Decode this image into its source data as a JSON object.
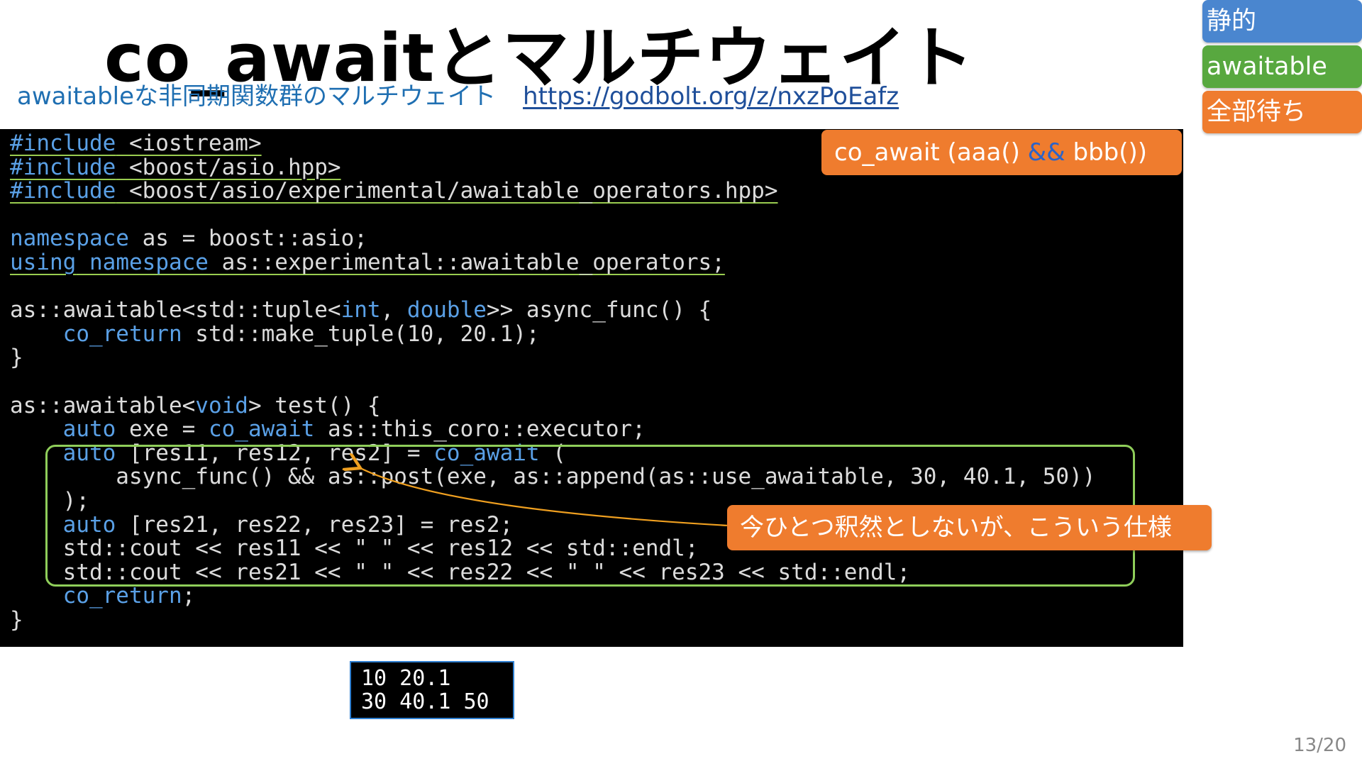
{
  "slide": {
    "title": "co_awaitとマルチウェイト",
    "subtitle": "awaitableな非同期関数群のマルチウェイト",
    "link": "https://godbolt.org/z/nxzPoEafz",
    "page_number": "13/20"
  },
  "tags": {
    "static": "静的",
    "awaitable": "awaitable",
    "all_wait": "全部待ち"
  },
  "callouts": {
    "expr_prefix": "co_await (aaa() ",
    "expr_amp": "&&",
    "expr_suffix": " bbb())",
    "note": "今ひとつ釈然としないが、こういう仕様"
  },
  "code": {
    "l1_pp": "#include",
    "l1_rest": " <iostream>",
    "l2_pp": "#include",
    "l2_rest": " <boost/asio.hpp>",
    "l3_pp": "#include",
    "l3_rest": " <boost/asio/experimental/awaitable_operators.hpp>",
    "l5_kw": "namespace",
    "l5_rest": " as = boost::asio;",
    "l6_kw1": "using",
    "l6_sp": " ",
    "l6_kw2": "namespace",
    "l6_rest": " as::experimental::awaitable_operators;",
    "l8_a": "as::awaitable<std::tuple<",
    "l8_kw1": "int",
    "l8_b": ", ",
    "l8_kw2": "double",
    "l8_c": ">> async_func() {",
    "l9_indent": "    ",
    "l9_kw": "co_return",
    "l9_rest": " std::make_tuple(10, 20.1);",
    "l10": "}",
    "l12_a": "as::awaitable<",
    "l12_kw": "void",
    "l12_b": "> test() {",
    "l13_indent": "    ",
    "l13_kw1": "auto",
    "l13_a": " exe = ",
    "l13_kw2": "co_await",
    "l13_b": " as::this_coro::executor;",
    "l14_indent": "    ",
    "l14_kw1": "auto",
    "l14_a": " [res11, res12, res2] = ",
    "l14_kw2": "co_await",
    "l14_b": " (",
    "l15": "        async_func() && as::post(exe, as::append(as::use_awaitable, 30, 40.1, 50))",
    "l16": "    );",
    "l17_indent": "    ",
    "l17_kw": "auto",
    "l17_rest": " [res21, res22, res23] = res2;",
    "l18": "    std::cout << res11 << \" \" << res12 << std::endl;",
    "l19": "    std::cout << res21 << \" \" << res22 << \" \" << res23 << std::endl;",
    "l20_indent": "    ",
    "l20_kw": "co_return",
    "l20_rest": ";",
    "l21": "}"
  },
  "output": {
    "line1": "10 20.1",
    "line2": "30 40.1 50"
  },
  "colors": {
    "keyword": "#5aa0e6",
    "callout": "#ef7c2e",
    "highlight_box": "#8fce5a",
    "tag_static": "#4a86cf",
    "tag_awaitable": "#58a83f",
    "tag_all_wait": "#ef7c2e"
  }
}
